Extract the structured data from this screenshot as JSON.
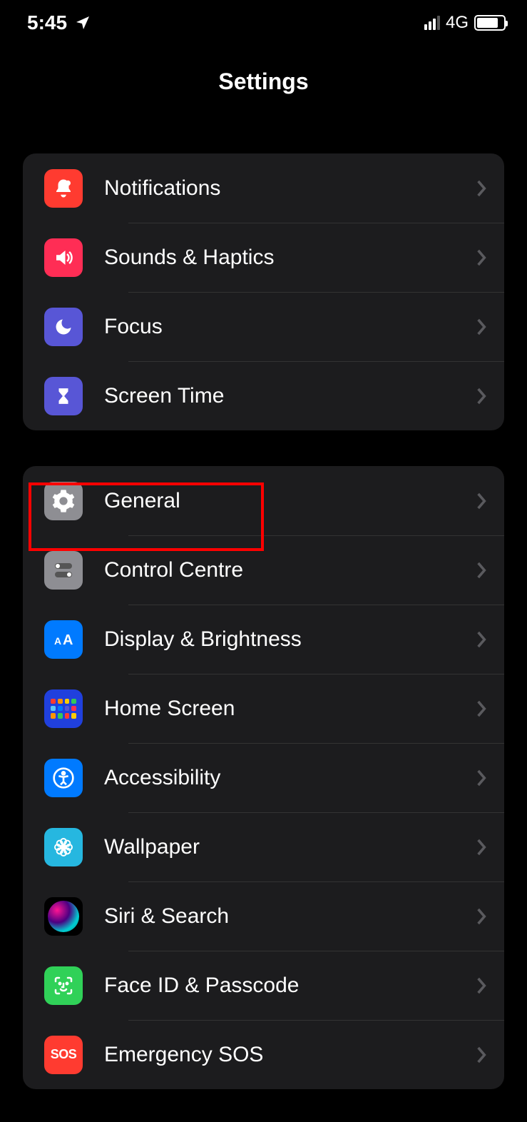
{
  "statusBar": {
    "time": "5:45",
    "network": "4G"
  },
  "header": {
    "title": "Settings"
  },
  "groups": [
    {
      "items": [
        {
          "label": "Notifications",
          "icon": "bell-icon",
          "bg": "bg-red"
        },
        {
          "label": "Sounds & Haptics",
          "icon": "speaker-icon",
          "bg": "bg-pink"
        },
        {
          "label": "Focus",
          "icon": "moon-icon",
          "bg": "bg-indigo"
        },
        {
          "label": "Screen Time",
          "icon": "hourglass-icon",
          "bg": "bg-indigo"
        }
      ]
    },
    {
      "items": [
        {
          "label": "General",
          "icon": "gear-icon",
          "bg": "bg-gray",
          "highlighted": true
        },
        {
          "label": "Control Centre",
          "icon": "toggles-icon",
          "bg": "bg-gray"
        },
        {
          "label": "Display & Brightness",
          "icon": "textsize-icon",
          "bg": "bg-blue"
        },
        {
          "label": "Home Screen",
          "icon": "homegrid-icon",
          "bg": "bg-darkblue"
        },
        {
          "label": "Accessibility",
          "icon": "accessibility-icon",
          "bg": "bg-blue"
        },
        {
          "label": "Wallpaper",
          "icon": "flower-icon",
          "bg": "bg-teal"
        },
        {
          "label": "Siri & Search",
          "icon": "siri-icon",
          "bg": "bg-black"
        },
        {
          "label": "Face ID & Passcode",
          "icon": "faceid-icon",
          "bg": "bg-green"
        },
        {
          "label": "Emergency SOS",
          "icon": "sos-icon",
          "bg": "bg-sosred"
        }
      ]
    }
  ]
}
